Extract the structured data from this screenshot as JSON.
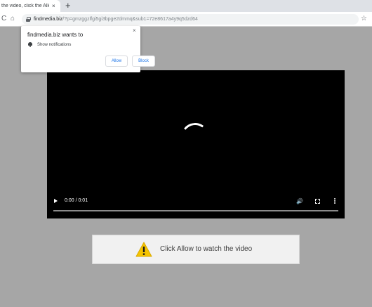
{
  "browser": {
    "tab": {
      "title": "the video, click the Allow",
      "close_glyph": "×"
    },
    "new_tab_glyph": "+",
    "toolbar": {
      "reload_glyph": "C",
      "home_glyph": "⌂",
      "url_host": "findmedia.biz",
      "url_rest": "/?p=gmzggzlfgi5gi3bpge2dmmq&sub1=72e8617a4y9q5dzd64",
      "star_glyph": "☆"
    }
  },
  "notification_popup": {
    "title": "findmedia.biz wants to",
    "close_glyph": "×",
    "permission_text": "Show notifications",
    "allow_label": "Allow",
    "block_label": "Block"
  },
  "video_player": {
    "time_display": "0:00 / 0:01",
    "volume_glyph": "🔊",
    "loading": true
  },
  "banner": {
    "message": "Click Allow to watch the video",
    "icon": "warning-icon"
  },
  "colors": {
    "page_background": "#a6a6a6",
    "warning_yellow": "#f5c400",
    "link_blue": "#1a73e8"
  }
}
